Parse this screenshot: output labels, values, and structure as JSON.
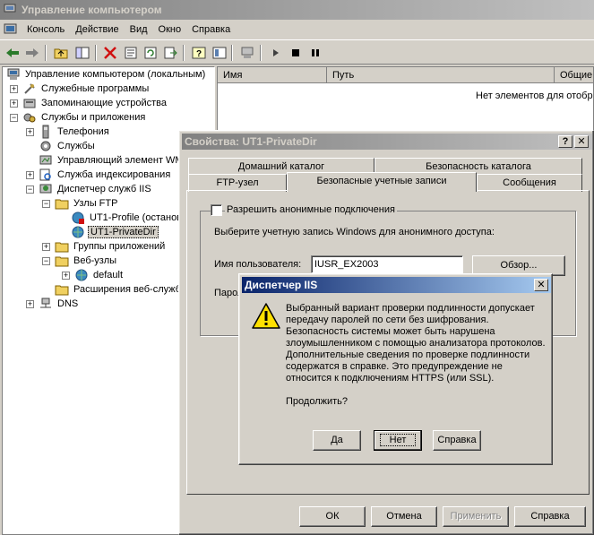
{
  "app": {
    "title": "Управление компьютером"
  },
  "menu": [
    {
      "label": "Консоль"
    },
    {
      "label": "Действие"
    },
    {
      "label": "Вид"
    },
    {
      "label": "Окно"
    },
    {
      "label": "Справка"
    }
  ],
  "toolbar": {
    "icons": [
      "back-arrow-icon",
      "forward-arrow-icon",
      "up-folder-icon",
      "show-tree-icon",
      "delete-icon",
      "properties-icon",
      "refresh-icon",
      "export-icon",
      "help-icon",
      "console-tree-icon",
      "computer-icon",
      "play-icon",
      "stop-icon",
      "pause-icon"
    ]
  },
  "tree": {
    "items": [
      {
        "label": "Управление компьютером (локальным)",
        "icon": "computer-icon"
      },
      {
        "label": "Служебные программы",
        "icon": "tools-icon"
      },
      {
        "label": "Запоминающие устройства",
        "icon": "storage-icon"
      },
      {
        "label": "Службы и приложения",
        "icon": "services-apps-icon"
      },
      {
        "label": "Телефония",
        "icon": "telephony-icon"
      },
      {
        "label": "Службы",
        "icon": "services-icon"
      },
      {
        "label": "Управляющий элемент WM",
        "icon": "wmi-icon"
      },
      {
        "label": "Служба индексирования",
        "icon": "indexing-icon"
      },
      {
        "label": "Диспетчер служб IIS",
        "icon": "iis-icon"
      },
      {
        "label": "Узлы FTP",
        "icon": "folder-icon"
      },
      {
        "label": "UT1-Profile (останов",
        "icon": "ftp-site-icon"
      },
      {
        "label": "UT1-PrivateDir",
        "icon": "ftp-site-icon"
      },
      {
        "label": "Группы приложений",
        "icon": "folder-icon"
      },
      {
        "label": "Веб-узлы",
        "icon": "folder-icon"
      },
      {
        "label": "default",
        "icon": "web-site-icon"
      },
      {
        "label": "Расширения веб-служб",
        "icon": "folder-icon"
      },
      {
        "label": "DNS",
        "icon": "dns-icon"
      }
    ]
  },
  "list": {
    "columns": [
      "Имя",
      "Путь",
      "Общие"
    ],
    "empty_text": "Нет элементов для отобра"
  },
  "properties": {
    "title": "Свойства: UT1-PrivateDir",
    "help_btn": "?",
    "close_btn": "✕",
    "tabs_back": [
      "Домашний каталог",
      "Безопасность каталога"
    ],
    "tabs_front": [
      "FTP-узел",
      "Безопасные учетные записи",
      "Сообщения"
    ],
    "anon_checkbox": "Разрешить анонимные подключения",
    "choose_text": "Выберите учетную запись Windows для анонимного доступа:",
    "user_label": "Имя пользователя:",
    "user_value": "IUSR_EX2003",
    "browse_btn": "Обзор...",
    "password_label": "Парол",
    "ok": "ОК",
    "cancel": "Отмена",
    "apply": "Применить",
    "help": "Справка"
  },
  "alert": {
    "title": "Диспетчер IIS",
    "close_btn": "✕",
    "lines": [
      "Выбранный вариант проверки подлинности допускает",
      "передачу паролей по сети без шифрования.",
      "Безопасность системы может быть нарушена",
      "злоумышленником с помощью анализатора протоколов.",
      "Дополнительные сведения по проверке подлинности",
      "содержатся в справке.  Это предупреждение не",
      "относится к подключениям HTTPS (или SSL)."
    ],
    "question": "Продолжить?",
    "yes": "Да",
    "no": "Нет",
    "help": "Справка"
  },
  "colors": {
    "active_title": "#0a246a",
    "inactive_title": "#808080",
    "face": "#d4d0c8"
  }
}
